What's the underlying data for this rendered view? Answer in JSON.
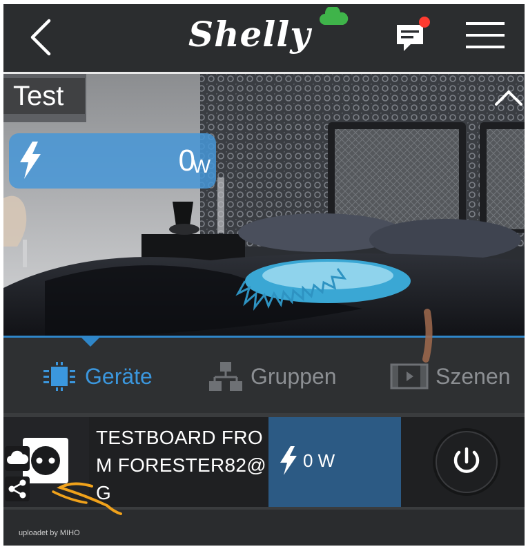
{
  "header": {
    "logo_text": "Shelly",
    "icons": {
      "back": "chevron-left-icon",
      "chat": "chat-bubble-icon",
      "menu": "hamburger-menu-icon"
    },
    "notification_dot_color": "#ff3b30"
  },
  "room": {
    "title": "Test",
    "power_value": "0",
    "power_unit": "W",
    "pill_color": "#4696d7"
  },
  "tabs": [
    {
      "label": "Geräte",
      "icon": "chip-icon",
      "active": true
    },
    {
      "label": "Gruppen",
      "icon": "group-tree-icon",
      "active": false
    },
    {
      "label": "Szenen",
      "icon": "film-icon",
      "active": false
    }
  ],
  "device": {
    "name": "TESTBOARD FROM FORESTER82@G",
    "power": "0 W",
    "icon": "power-socket-icon",
    "badges": [
      "cloud-icon",
      "share-icon"
    ],
    "accent": "#2c5a84"
  },
  "footer": {
    "watermark": "uploadet by MIHO"
  }
}
